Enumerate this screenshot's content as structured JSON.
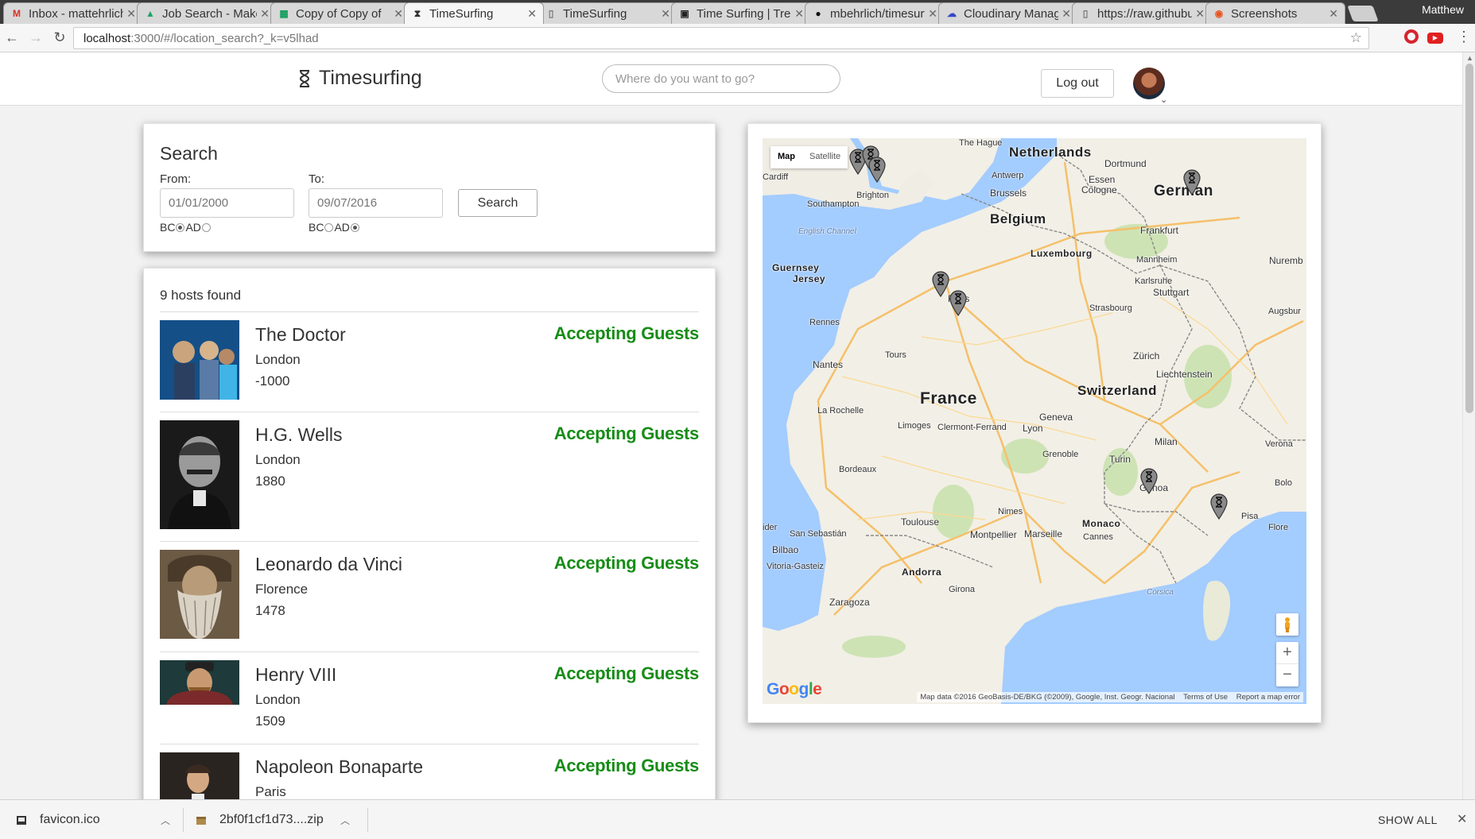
{
  "browser": {
    "tabs": [
      {
        "label": "Inbox - mattehrlich",
        "favicon": "gmail-icon",
        "favicon_color": "#d93025",
        "favicon_glyph": "M"
      },
      {
        "label": "Job Search - Maker",
        "favicon": "drive-icon",
        "favicon_color": "#1fa463",
        "favicon_glyph": "▲"
      },
      {
        "label": "Copy of Copy of",
        "favicon": "sheets-icon",
        "favicon_color": "#0f9d58",
        "favicon_glyph": "▦"
      },
      {
        "label": "TimeSurfing",
        "favicon": "hourglass-icon",
        "favicon_color": "#333333",
        "favicon_glyph": "⧗",
        "active": true
      },
      {
        "label": "TimeSurfing",
        "favicon": "page-icon",
        "favicon_color": "#777777",
        "favicon_glyph": "▯"
      },
      {
        "label": "Time Surfing | Trello",
        "favicon": "trello-icon",
        "favicon_color": "#222222",
        "favicon_glyph": "▣"
      },
      {
        "label": "mbehrlich/timesurfing",
        "favicon": "github-icon",
        "favicon_color": "#111111",
        "favicon_glyph": "●"
      },
      {
        "label": "Cloudinary Management",
        "favicon": "cloudinary-icon",
        "favicon_color": "#3448c5",
        "favicon_glyph": "☁"
      },
      {
        "label": "https://raw.githubusercontent",
        "favicon": "page-icon",
        "favicon_color": "#777777",
        "favicon_glyph": "▯"
      },
      {
        "label": "Screenshots",
        "favicon": "ubuntu-icon",
        "favicon_color": "#e95420",
        "favicon_glyph": "◉"
      }
    ],
    "profile_name": "Matthew",
    "url_host": "localhost",
    "url_path": ":3000/#/location_search?_k=v5lhad"
  },
  "header": {
    "brand": "Timesurfing",
    "search_placeholder": "Where do you want to go?",
    "logout_label": "Log out"
  },
  "search": {
    "title": "Search",
    "from_label": "From:",
    "to_label": "To:",
    "from_value": "01/01/2000",
    "to_value": "09/07/2016",
    "bc_label": "BC",
    "ad_label": "AD",
    "from_era": "BC",
    "to_era": "AD",
    "button_label": "Search"
  },
  "results": {
    "count_text": "9 hosts found",
    "hosts": [
      {
        "name": "The Doctor",
        "city": "London",
        "year": "-1000",
        "status": "Accepting Guests"
      },
      {
        "name": "H.G. Wells",
        "city": "London",
        "year": "1880",
        "status": "Accepting Guests"
      },
      {
        "name": "Leonardo da Vinci",
        "city": "Florence",
        "year": "1478",
        "status": "Accepting Guests"
      },
      {
        "name": "Henry VIII",
        "city": "London",
        "year": "1509",
        "status": "Accepting Guests"
      },
      {
        "name": "Napoleon Bonaparte",
        "city": "Paris",
        "year": "",
        "status": "Accepting Guests"
      }
    ],
    "status_color": "#178c17"
  },
  "map": {
    "type_map": "Map",
    "type_satellite": "Satellite",
    "attribution": "Map data ©2016 GeoBasis-DE/BKG (©2009), Google, Inst. Geogr. Nacional",
    "terms": "Terms of Use",
    "report": "Report a map error",
    "zoom_in": "+",
    "zoom_out": "−",
    "labels": {
      "netherlands": "Netherlands",
      "the_hague": "The Hague",
      "belgium": "Belgium",
      "germany": "German",
      "france": "France",
      "switzerland": "Switzerland",
      "luxembourg": "Luxembourg",
      "monaco": "Monaco",
      "andorra": "Andorra",
      "guernsey": "Guernsey",
      "jersey": "Jersey",
      "english_channel": "English Channel",
      "cardiff": "Cardiff",
      "oxford": "ford",
      "brighton": "Brighton",
      "southampton": "Southampton",
      "antwerp": "Antwerp",
      "brussels": "Brussels",
      "dortmund": "Dortmund",
      "essen": "Essen",
      "cologne": "Cologne",
      "frankfurt": "Frankfurt",
      "mannheim": "Mannheim",
      "nuremberg": "Nuremb",
      "karlsruhe": "Karlsruhe",
      "stuttgart": "Stuttgart",
      "strasbourg": "Strasbourg",
      "augsburg": "Augsbur",
      "zurich": "Zürich",
      "liechtenstein": "Liechtenstein",
      "paris": "Paris",
      "rennes": "Rennes",
      "tours": "Tours",
      "nantes": "Nantes",
      "la_rochelle": "La Rochelle",
      "limoges": "Limoges",
      "clermont": "Clermont-Ferrand",
      "lyon": "Lyon",
      "geneva": "Geneva",
      "grenoble": "Grenoble",
      "milan": "Milan",
      "turin": "Turin",
      "verona": "Verona",
      "bologna": "Bolo",
      "genoa": "Genoa",
      "pisa": "Pisa",
      "florence": "Flore",
      "bordeaux": "Bordeaux",
      "toulouse": "Toulouse",
      "montpellier": "Montpellier",
      "nimes": "Nimes",
      "marseille": "Marseille",
      "cannes": "Cannes",
      "san_sebastian": "San Sebastián",
      "bilbao": "Bilbao",
      "vitoria": "Vitoria-Gasteiz",
      "irun": "ider",
      "girona": "Girona",
      "zaragoza": "Zaragoza",
      "corsica": "Corsica",
      "google": "Google"
    }
  },
  "downloads": {
    "items": [
      {
        "name": "favicon.ico",
        "icon": "file-icon"
      },
      {
        "name": "2bf0f1cf1d73....zip",
        "icon": "archive-icon"
      }
    ],
    "show_all": "SHOW ALL"
  }
}
